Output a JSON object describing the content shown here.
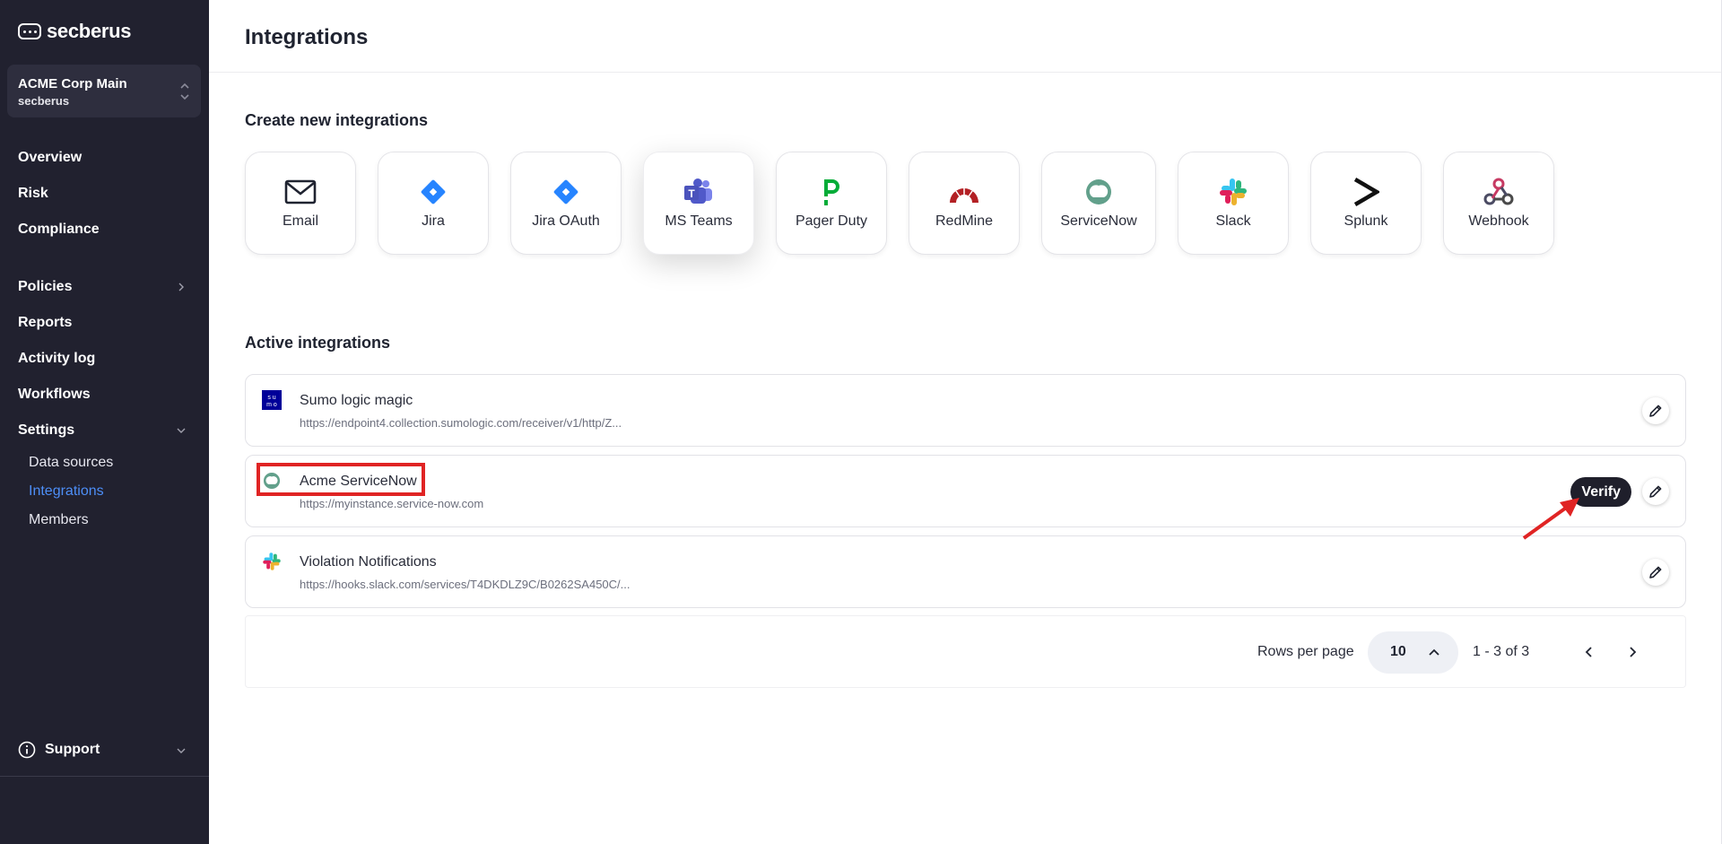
{
  "brand": {
    "name": "secberus"
  },
  "org": {
    "name": "ACME Corp Main",
    "sub": "secberus"
  },
  "nav": {
    "overview": "Overview",
    "risk": "Risk",
    "compliance": "Compliance",
    "policies": "Policies",
    "reports": "Reports",
    "activity_log": "Activity log",
    "workflows": "Workflows",
    "settings": "Settings",
    "settings_sub": {
      "data_sources": "Data sources",
      "integrations": "Integrations",
      "members": "Members"
    },
    "support": "Support"
  },
  "page": {
    "title": "Integrations"
  },
  "create_section": {
    "title": "Create new integrations",
    "cards": [
      {
        "label": "Email",
        "icon": "envelope-icon"
      },
      {
        "label": "Jira",
        "icon": "jira-icon"
      },
      {
        "label": "Jira OAuth",
        "icon": "jira-oauth-icon"
      },
      {
        "label": "MS Teams",
        "icon": "ms-teams-icon"
      },
      {
        "label": "Pager Duty",
        "icon": "pagerduty-icon"
      },
      {
        "label": "RedMine",
        "icon": "redmine-icon"
      },
      {
        "label": "ServiceNow",
        "icon": "servicenow-icon"
      },
      {
        "label": "Slack",
        "icon": "slack-icon"
      },
      {
        "label": "Splunk",
        "icon": "splunk-icon"
      },
      {
        "label": "Webhook",
        "icon": "webhook-icon"
      }
    ]
  },
  "active_section": {
    "title": "Active integrations",
    "rows": [
      {
        "name": "Sumo logic magic",
        "url": "https://endpoint4.collection.sumologic.com/receiver/v1/http/Z...",
        "icon": "sumo-logic-icon",
        "sumo_text": "su mo"
      },
      {
        "name": "Acme ServiceNow",
        "url": "https://myinstance.service-now.com",
        "icon": "servicenow-icon",
        "verify_label": "Verify"
      },
      {
        "name": "Violation Notifications",
        "url": "https://hooks.slack.com/services/T4DKDLZ9C/B0262SA450C/...",
        "icon": "slack-icon"
      }
    ]
  },
  "pagination": {
    "rows_per_page_label": "Rows per page",
    "rows_per_page_value": "10",
    "range": "1 - 3 of 3"
  },
  "colors": {
    "sidebar_bg": "#21212f",
    "active_link": "#4d8ef7",
    "annotation_red": "#e02424",
    "verify_bg": "#1f1f2b"
  }
}
